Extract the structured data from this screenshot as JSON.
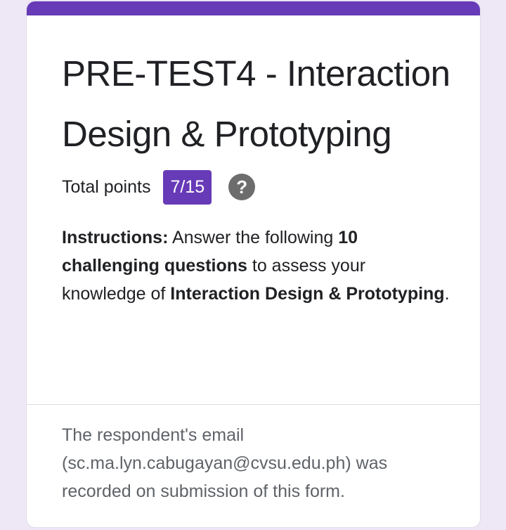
{
  "form": {
    "title": "PRE-TEST4 - Interaction Design & Prototyping",
    "total_points_label": "Total points",
    "score": "7/15",
    "help_icon": "?",
    "instructions": {
      "label": "Instructions:",
      "t1": " Answer the following ",
      "b1": "10 challenging questions",
      "t2": " to assess your knowledge of ",
      "b2": "Interaction Design & Prototyping",
      "t3": "."
    },
    "email_notice": "The respondent's email (sc.ma.lyn.cabugayan@cvsu.edu.ph) was recorded on submission of this form."
  },
  "colors": {
    "accent": "#673ab7",
    "background": "#ede7f6"
  }
}
